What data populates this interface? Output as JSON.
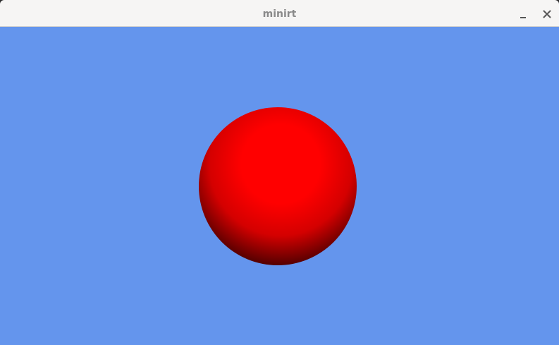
{
  "window": {
    "title": "minirt",
    "minimize_icon": "minimize-icon",
    "close_icon": "close-icon"
  },
  "scene": {
    "background_color": "#6495ed",
    "object": "sphere",
    "sphere_color": "#ff0000"
  }
}
